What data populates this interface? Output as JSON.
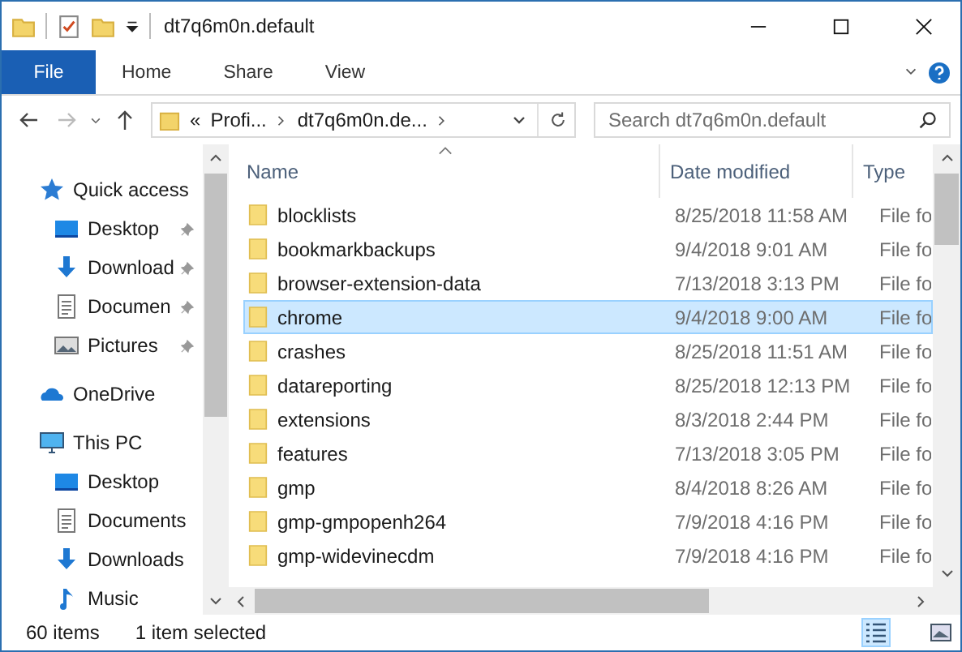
{
  "window": {
    "title": "dt7q6m0n.default"
  },
  "ribbon_tabs": [
    {
      "label": "File",
      "selected": true
    },
    {
      "label": "Home",
      "selected": false
    },
    {
      "label": "Share",
      "selected": false
    },
    {
      "label": "View",
      "selected": false
    }
  ],
  "address": {
    "segments": [
      "«",
      "Profi...",
      "dt7q6m0n.de..."
    ]
  },
  "search": {
    "placeholder": "Search dt7q6m0n.default"
  },
  "nav": [
    {
      "label": "Quick access",
      "kind": "star",
      "children": [
        {
          "label": "Desktop",
          "kind": "desktop",
          "pinned": true
        },
        {
          "label": "Download",
          "kind": "download",
          "pinned": true
        },
        {
          "label": "Documen",
          "kind": "document",
          "pinned": true
        },
        {
          "label": "Pictures",
          "kind": "picture",
          "pinned": true
        }
      ]
    },
    {
      "label": "OneDrive",
      "kind": "cloud"
    },
    {
      "label": "This PC",
      "kind": "pc",
      "children": [
        {
          "label": "Desktop",
          "kind": "desktop",
          "pinned": false
        },
        {
          "label": "Documents",
          "kind": "document",
          "pinned": false
        },
        {
          "label": "Downloads",
          "kind": "download",
          "pinned": false
        },
        {
          "label": "Music",
          "kind": "music",
          "pinned": false
        }
      ]
    }
  ],
  "columns": [
    "Name",
    "Date modified",
    "Type"
  ],
  "rows": [
    {
      "name": "blocklists",
      "date": "8/25/2018 11:58 AM",
      "type": "File fo",
      "selected": false
    },
    {
      "name": "bookmarkbackups",
      "date": "9/4/2018 9:01 AM",
      "type": "File fo",
      "selected": false
    },
    {
      "name": "browser-extension-data",
      "date": "7/13/2018 3:13 PM",
      "type": "File fo",
      "selected": false
    },
    {
      "name": "chrome",
      "date": "9/4/2018 9:00 AM",
      "type": "File fo",
      "selected": true
    },
    {
      "name": "crashes",
      "date": "8/25/2018 11:51 AM",
      "type": "File fo",
      "selected": false
    },
    {
      "name": "datareporting",
      "date": "8/25/2018 12:13 PM",
      "type": "File fo",
      "selected": false
    },
    {
      "name": "extensions",
      "date": "8/3/2018 2:44 PM",
      "type": "File fo",
      "selected": false
    },
    {
      "name": "features",
      "date": "7/13/2018 3:05 PM",
      "type": "File fo",
      "selected": false
    },
    {
      "name": "gmp",
      "date": "8/4/2018 8:26 AM",
      "type": "File fo",
      "selected": false
    },
    {
      "name": "gmp-gmpopenh264",
      "date": "7/9/2018 4:16 PM",
      "type": "File fo",
      "selected": false
    },
    {
      "name": "gmp-widevinecdm",
      "date": "7/9/2018 4:16 PM",
      "type": "File fo",
      "selected": false
    }
  ],
  "status_bar": {
    "count": "60 items",
    "selection": "1 item selected"
  }
}
